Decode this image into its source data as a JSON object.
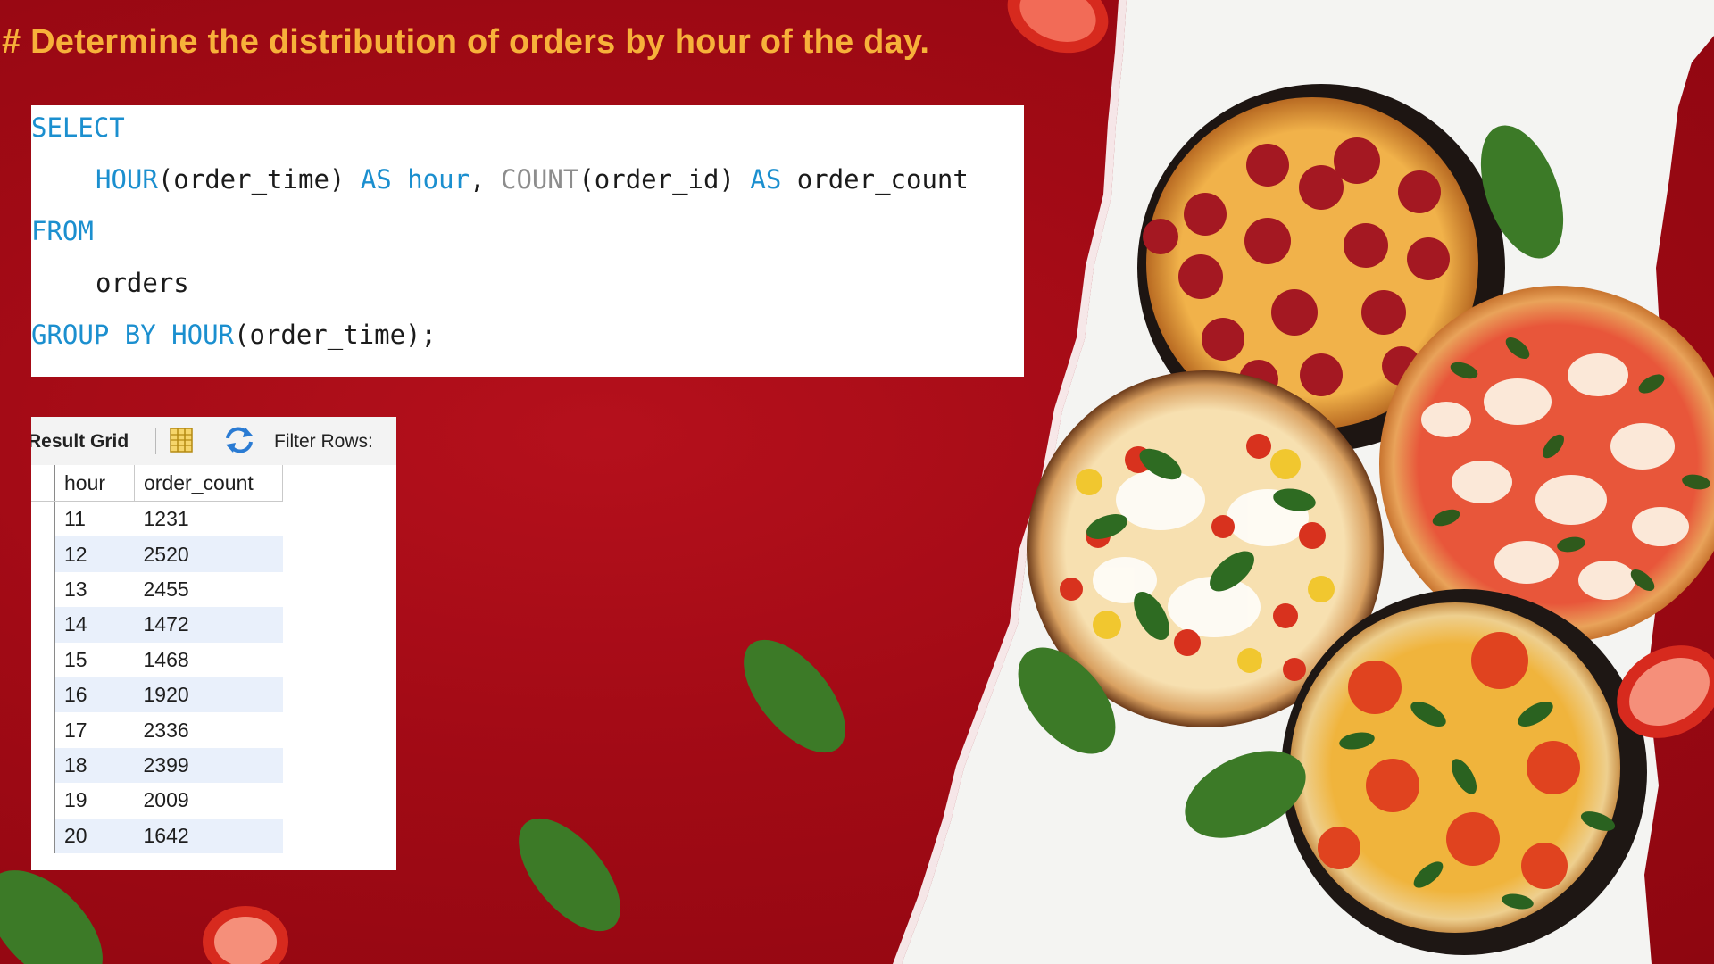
{
  "title": "# Determine the distribution of orders by hour of the day.",
  "query": {
    "line1": {
      "kw": "SELECT"
    },
    "line2": {
      "fn1": "HOUR",
      "arg1": "(order_time)",
      "as1": "AS",
      "alias1": "hour",
      "comma": ",",
      "fn2": "COUNT",
      "arg2": "(order_id)",
      "as2": "AS",
      "alias2": "order_count"
    },
    "line3": {
      "kw": "FROM"
    },
    "line4": {
      "table": "orders"
    },
    "line5": {
      "kw": "GROUP BY",
      "fn": "HOUR",
      "arg": "(order_time);"
    }
  },
  "result_grid": {
    "label": "Result Grid",
    "filter_label": "Filter Rows:",
    "columns": [
      "hour",
      "order_count"
    ],
    "rows": [
      [
        "11",
        "1231"
      ],
      [
        "12",
        "2520"
      ],
      [
        "13",
        "2455"
      ],
      [
        "14",
        "1472"
      ],
      [
        "15",
        "1468"
      ],
      [
        "16",
        "1920"
      ],
      [
        "17",
        "2336"
      ],
      [
        "18",
        "2399"
      ],
      [
        "19",
        "2009"
      ],
      [
        "20",
        "1642"
      ]
    ]
  },
  "colors": {
    "background": "#a50b16",
    "title": "#f7b13a",
    "keyword": "#1b8fcf",
    "alt_row": "#e9f0fb"
  },
  "icons": [
    "grid-view-icon",
    "refresh-icon"
  ]
}
